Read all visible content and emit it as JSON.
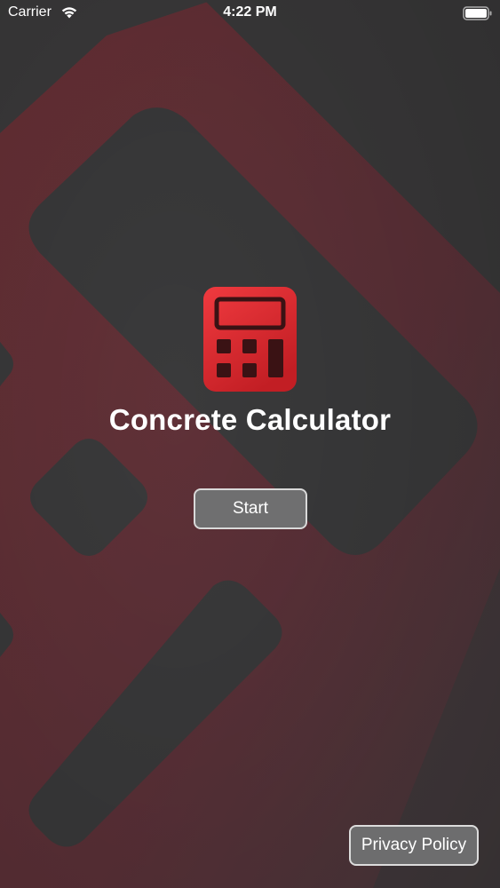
{
  "status_bar": {
    "carrier": "Carrier",
    "time": "4:22 PM",
    "wifi_icon": "wifi-icon",
    "battery_icon": "battery-icon"
  },
  "main": {
    "app_icon": "calculator-icon",
    "title": "Concrete Calculator",
    "start_label": "Start"
  },
  "footer": {
    "privacy_label": "Privacy Policy"
  },
  "colors": {
    "background": "#3b3a3b",
    "pattern_red": "#6a2f33",
    "accent_red": "#e42a2f",
    "button_fill": "#6f6f70",
    "button_border": "#d9d9d9",
    "text": "#ffffff"
  }
}
